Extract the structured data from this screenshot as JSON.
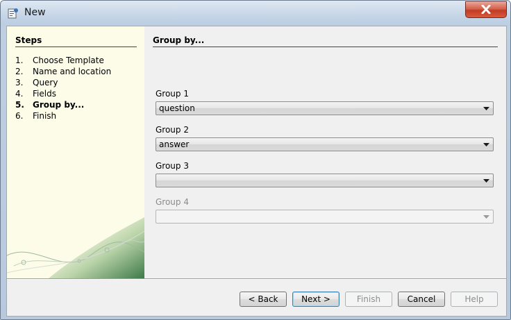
{
  "window": {
    "title": "New",
    "icons": {
      "app": "wizard-app-icon",
      "close": "close-x-icon"
    },
    "colors": {
      "close_button": "#c23b22",
      "steps_panel_bg": "#fcfce8",
      "client_bg": "#f0f0f0"
    }
  },
  "steps": {
    "heading": "Steps",
    "items": [
      {
        "num": "1.",
        "label": "Choose Template"
      },
      {
        "num": "2.",
        "label": "Name and location"
      },
      {
        "num": "3.",
        "label": "Query"
      },
      {
        "num": "4.",
        "label": "Fields"
      },
      {
        "num": "5.",
        "label": "Group by..."
      },
      {
        "num": "6.",
        "label": "Finish"
      }
    ],
    "current_index": 4
  },
  "content": {
    "heading": "Group by...",
    "groups": [
      {
        "label": "Group 1",
        "value": "question",
        "enabled": true
      },
      {
        "label": "Group 2",
        "value": "answer",
        "enabled": true
      },
      {
        "label": "Group 3",
        "value": "",
        "enabled": true
      },
      {
        "label": "Group 4",
        "value": "",
        "enabled": false
      }
    ]
  },
  "buttons": {
    "back": "< Back",
    "next": "Next >",
    "finish": "Finish",
    "cancel": "Cancel",
    "help": "Help"
  }
}
